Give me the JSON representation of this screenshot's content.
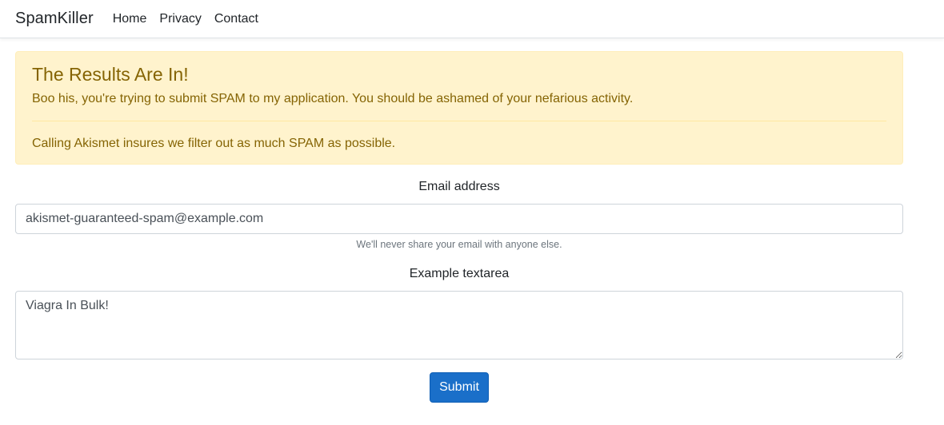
{
  "navbar": {
    "brand": "SpamKiller",
    "links": [
      "Home",
      "Privacy",
      "Contact"
    ]
  },
  "alert": {
    "heading": "The Results Are In!",
    "message": "Boo his, you're trying to submit SPAM to my application. You should be ashamed of your nefarious activity.",
    "footer": "Calling Akismet insures we filter out as much SPAM as possible."
  },
  "form": {
    "email_label": "Email address",
    "email_value": "akismet-guaranteed-spam@example.com",
    "email_help": "We'll never share your email with anyone else.",
    "textarea_label": "Example textarea",
    "textarea_value": "Viagra In Bulk!",
    "submit_label": "Submit"
  },
  "colors": {
    "alert_bg": "#fff3cd",
    "alert_text": "#856404",
    "button_bg": "#1a6fc9"
  }
}
